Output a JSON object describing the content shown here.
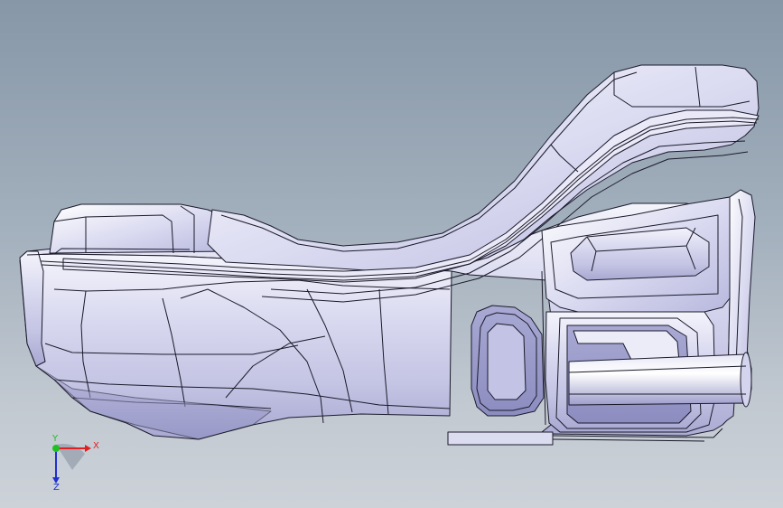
{
  "viewport": {
    "model": "bracket-part",
    "background_colors": [
      "#8797a8",
      "#ccd2d8"
    ],
    "part_color": "#d7d7ee",
    "edge_color": "#1a1a2a"
  },
  "triad": {
    "x_label": "X",
    "z_label": "Z",
    "y_label": "Y",
    "x_color": "#e02020",
    "y_color": "#20c020",
    "z_color": "#2030d0"
  }
}
